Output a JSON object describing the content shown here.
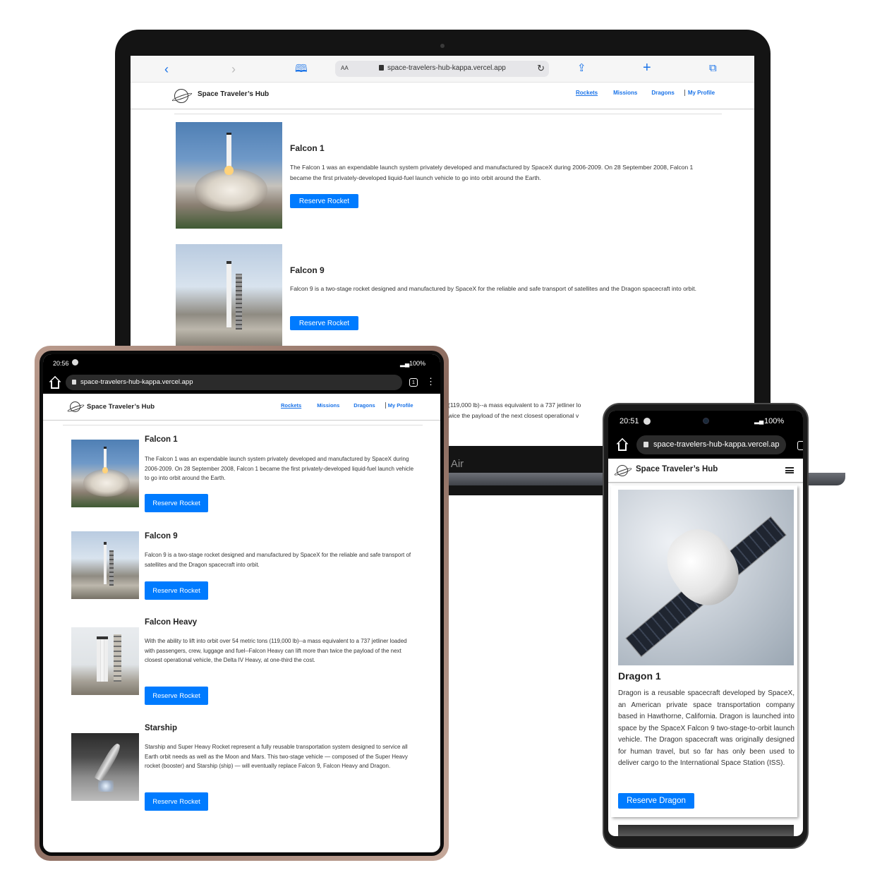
{
  "site": {
    "brand": "Space Traveler’s Hub",
    "url": "space-travelers-hub-kappa.vercel.app",
    "nav": [
      "Rockets",
      "Missions",
      "Dragons",
      "My Profile"
    ]
  },
  "laptop": {
    "model_label": "k Air",
    "address_bar_aa": "AA",
    "rockets": [
      {
        "name": "Falcon 1",
        "description": "The Falcon 1 was an expendable launch system privately developed and manufactured by SpaceX during 2006-2009. On 28 September 2008, Falcon 1 became the first privately-developed liquid-fuel launch vehicle to go into orbit around the Earth.",
        "button": "Reserve Rocket"
      },
      {
        "name": "Falcon 9",
        "description": "Falcon 9 is a two-stage rocket designed and manufactured by SpaceX for the reliable and safe transport of satellites and the Dragon spacecraft into orbit.",
        "button": "Reserve Rocket"
      }
    ],
    "visible_fragment_1": "(119,000 lb)--a mass equivalent to a 737 jetliner lo",
    "visible_fragment_2": "wice the payload of the next closest operational v"
  },
  "tablet": {
    "time": "20:56",
    "battery": "100%",
    "tabs_count": "1",
    "rockets": [
      {
        "name": "Falcon 1",
        "description": "The Falcon 1 was an expendable launch system privately developed and manufactured by SpaceX during 2006-2009. On 28 September 2008, Falcon 1 became the first privately-developed liquid-fuel launch vehicle to go into orbit around the Earth.",
        "button": "Reserve Rocket"
      },
      {
        "name": "Falcon 9",
        "description": "Falcon 9 is a two-stage rocket designed and manufactured by SpaceX for the reliable and safe transport of satellites and the Dragon spacecraft into orbit.",
        "button": "Reserve Rocket"
      },
      {
        "name": "Falcon Heavy",
        "description": "With the ability to lift into orbit over 54 metric tons (119,000 lb)--a mass equivalent to a 737 jetliner loaded with passengers, crew, luggage and fuel--Falcon Heavy can lift more than twice the payload of the next closest operational vehicle, the Delta IV Heavy, at one-third the cost.",
        "button": "Reserve Rocket"
      },
      {
        "name": "Starship",
        "description": "Starship and Super Heavy Rocket represent a fully reusable transportation system designed to service all Earth orbit needs as well as the Moon and Mars. This two-stage vehicle — composed of the Super Heavy rocket (booster) and Starship (ship) — will eventually replace Falcon 9, Falcon Heavy and Dragon.",
        "button": "Reserve Rocket"
      }
    ]
  },
  "phone": {
    "time": "20:51",
    "battery": "100%",
    "url_visible": "space-travelers-hub-kappa.vercel.ap",
    "dragon": {
      "name": "Dragon 1",
      "description": "Dragon is a reusable spacecraft developed by SpaceX, an American private space transportation company based in Hawthorne, California. Dragon is launched into space by the SpaceX Falcon 9 two-stage-to-orbit launch vehicle. The Dragon spacecraft was originally designed for human travel, but so far has only been used to deliver cargo to the International Space Station (ISS).",
      "button": "Reserve Dragon"
    }
  },
  "colors": {
    "accent": "#007bff",
    "link": "#1a73e8"
  },
  "icons": [
    "back-icon",
    "forward-icon",
    "bookmarks-icon",
    "lock-icon",
    "reload-icon",
    "share-icon",
    "new-tab-icon",
    "tabs-icon",
    "home-icon",
    "menu-icon",
    "hamburger-icon",
    "logo-planet-icon"
  ]
}
